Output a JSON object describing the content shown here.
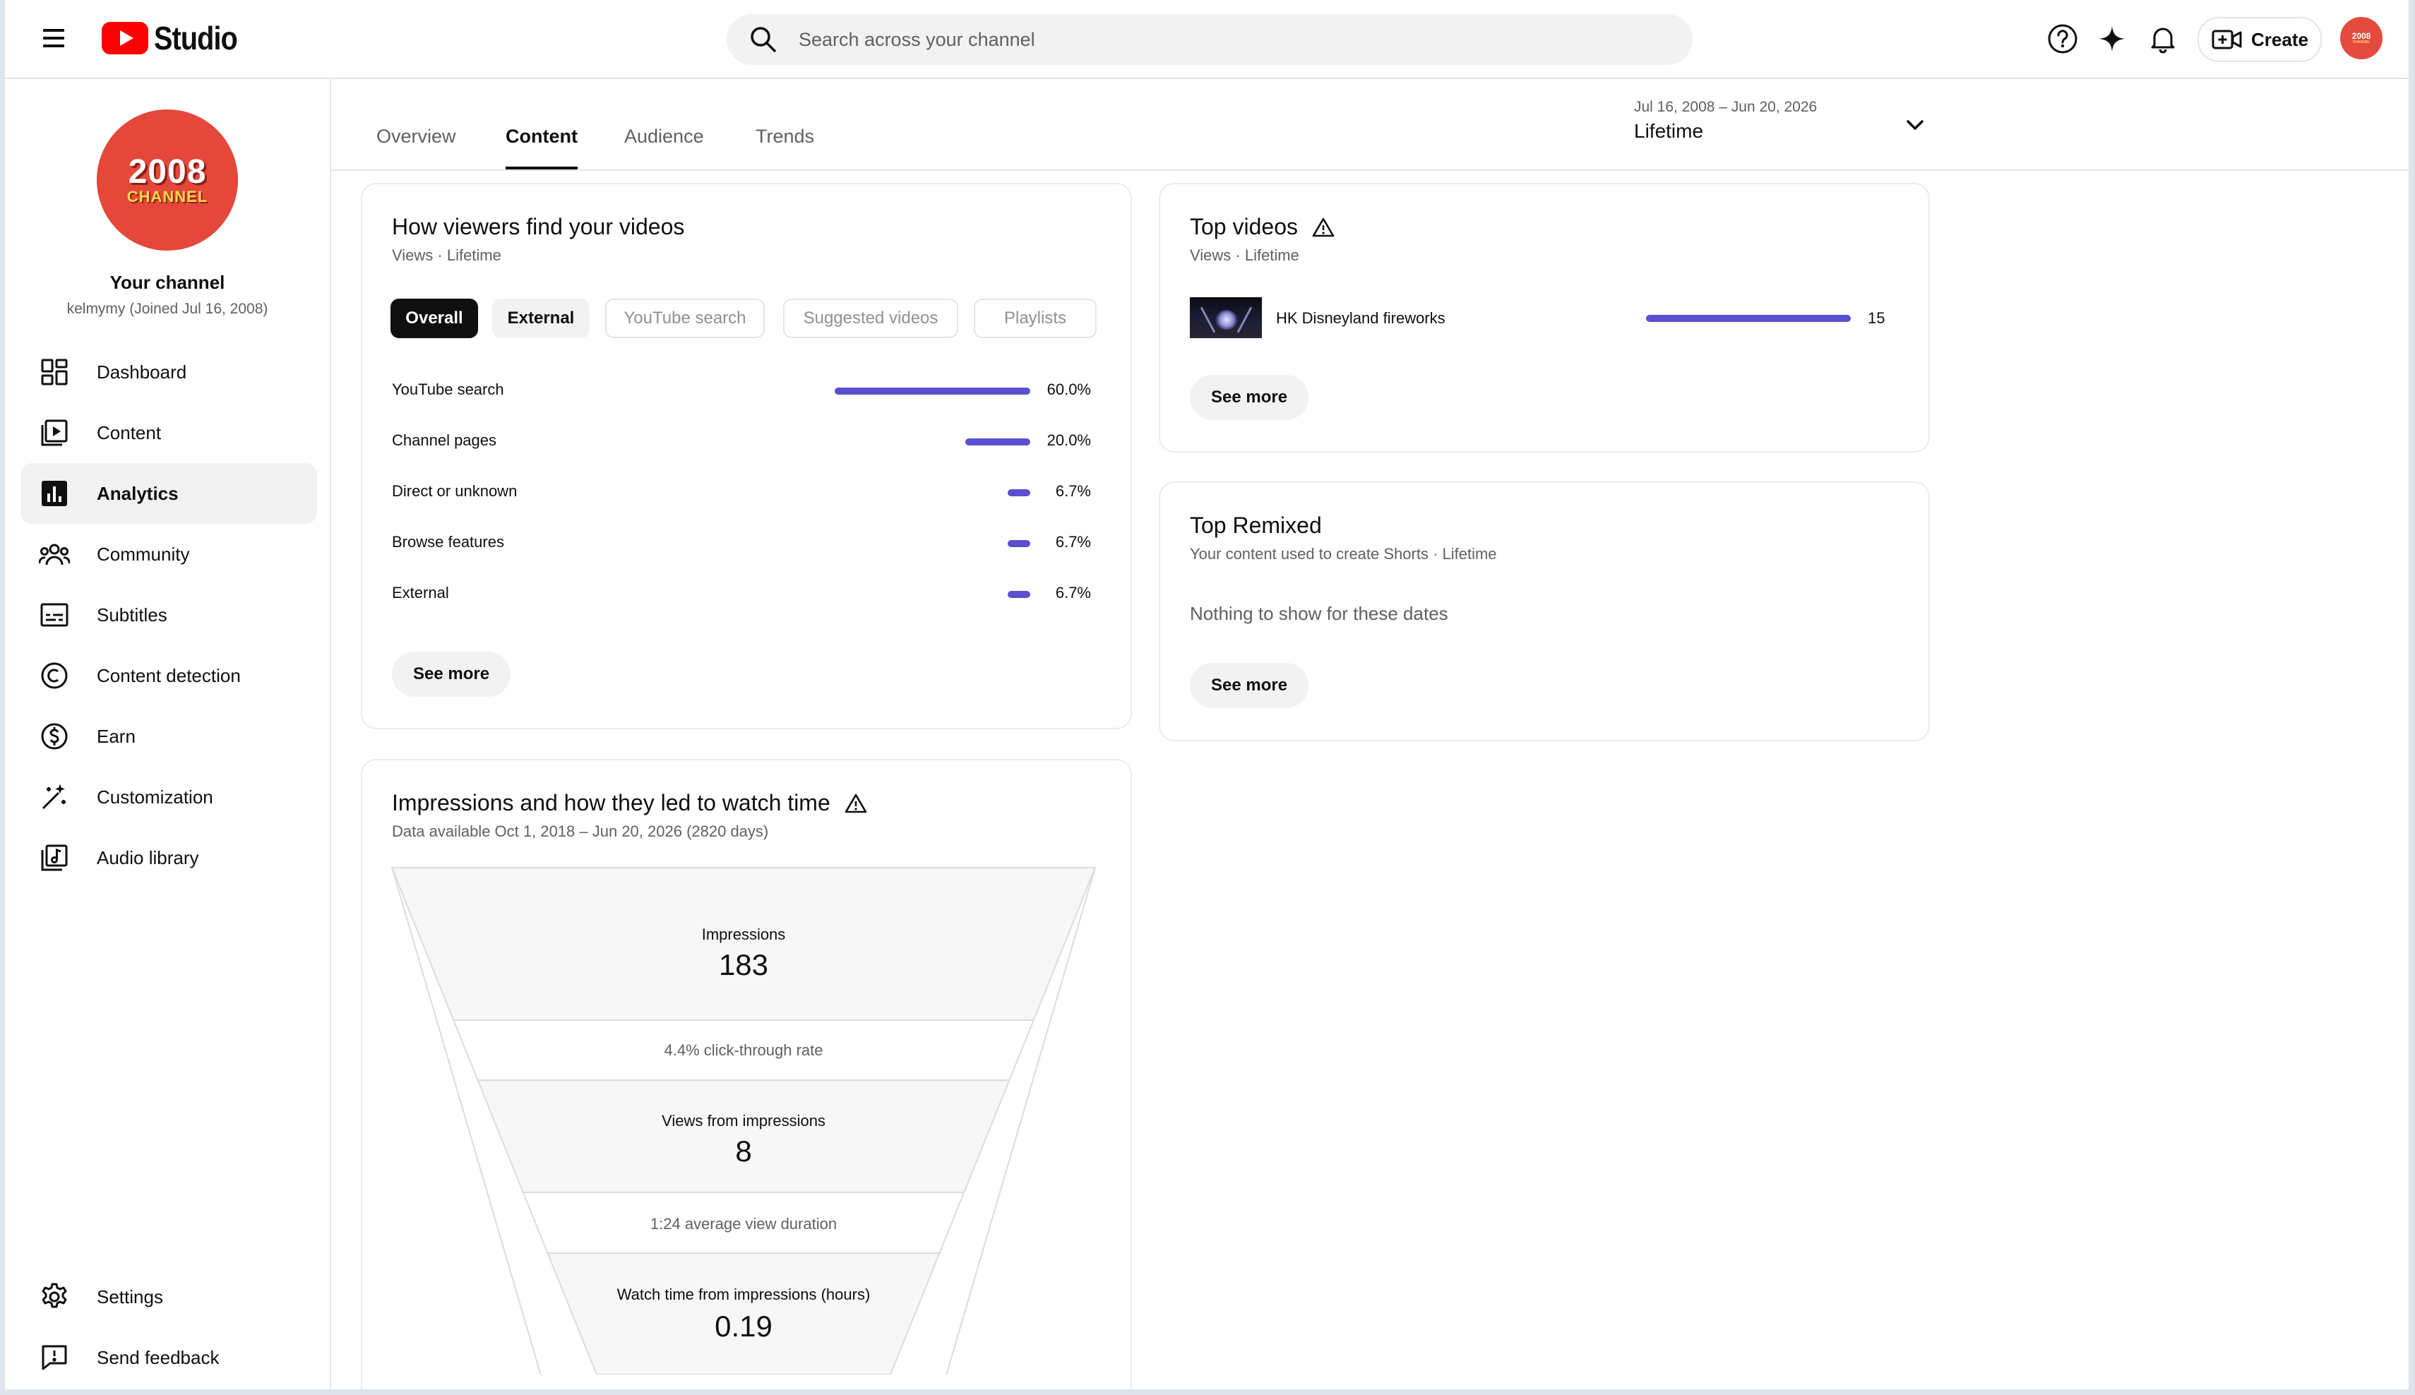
{
  "header": {
    "app_name": "Studio",
    "search_placeholder": "Search across your channel",
    "create_label": "Create",
    "avatar_text_top": "2008",
    "avatar_text_bottom": "CHANNEL"
  },
  "sidebar": {
    "avatar_text_top": "2008",
    "avatar_text_bottom": "CHANNEL",
    "channel_title": "Your channel",
    "channel_subtitle": "kelmymy (Joined Jul 16, 2008)",
    "items": [
      {
        "label": "Dashboard",
        "icon": "dashboard-icon"
      },
      {
        "label": "Content",
        "icon": "content-icon"
      },
      {
        "label": "Analytics",
        "icon": "analytics-icon",
        "active": true
      },
      {
        "label": "Community",
        "icon": "community-icon"
      },
      {
        "label": "Subtitles",
        "icon": "subtitles-icon"
      },
      {
        "label": "Content detection",
        "icon": "copyright-icon"
      },
      {
        "label": "Earn",
        "icon": "earn-icon"
      },
      {
        "label": "Customization",
        "icon": "magic-wand-icon"
      },
      {
        "label": "Audio library",
        "icon": "audio-library-icon"
      }
    ],
    "bottom_items": [
      {
        "label": "Settings",
        "icon": "gear-icon"
      },
      {
        "label": "Send feedback",
        "icon": "feedback-icon"
      }
    ]
  },
  "tabs": [
    {
      "label": "Overview"
    },
    {
      "label": "Content",
      "active": true
    },
    {
      "label": "Audience"
    },
    {
      "label": "Trends"
    }
  ],
  "date_range": {
    "range": "Jul 16, 2008 – Jun 20, 2026",
    "label": "Lifetime"
  },
  "traffic_sources": {
    "title": "How viewers find your videos",
    "subtitle": "Views · Lifetime",
    "chips": [
      {
        "label": "Overall",
        "state": "selected"
      },
      {
        "label": "External",
        "state": "enabled"
      },
      {
        "label": "YouTube search",
        "state": "disabled"
      },
      {
        "label": "Suggested videos",
        "state": "disabled"
      },
      {
        "label": "Playlists",
        "state": "disabled"
      }
    ],
    "rows": [
      {
        "label": "YouTube search",
        "value": "60.0%",
        "fraction": 0.6
      },
      {
        "label": "Channel pages",
        "value": "20.0%",
        "fraction": 0.2
      },
      {
        "label": "Direct or unknown",
        "value": "6.7%",
        "fraction": 0.067
      },
      {
        "label": "Browse features",
        "value": "6.7%",
        "fraction": 0.067
      },
      {
        "label": "External",
        "value": "6.7%",
        "fraction": 0.067
      }
    ],
    "see_more": "See more",
    "bar_color": "#5a4fcf"
  },
  "top_videos": {
    "title": "Top videos",
    "subtitle": "Views · Lifetime",
    "videos": [
      {
        "title": "HK Disneyland fireworks",
        "views": "15"
      }
    ],
    "see_more": "See more"
  },
  "top_remixed": {
    "title": "Top Remixed",
    "subtitle": "Your content used to create Shorts · Lifetime",
    "empty_message": "Nothing to show for these dates",
    "see_more": "See more"
  },
  "impressions": {
    "title": "Impressions and how they led to watch time",
    "subtitle": "Data available Oct 1, 2018 – Jun 20, 2026 (2820 days)",
    "impressions_label": "Impressions",
    "impressions_value": "183",
    "ctr": "4.4% click-through rate",
    "views_label": "Views from impressions",
    "views_value": "8",
    "avg_duration": "1:24 average view duration",
    "watch_label": "Watch time from impressions (hours)",
    "watch_value": "0.19"
  }
}
